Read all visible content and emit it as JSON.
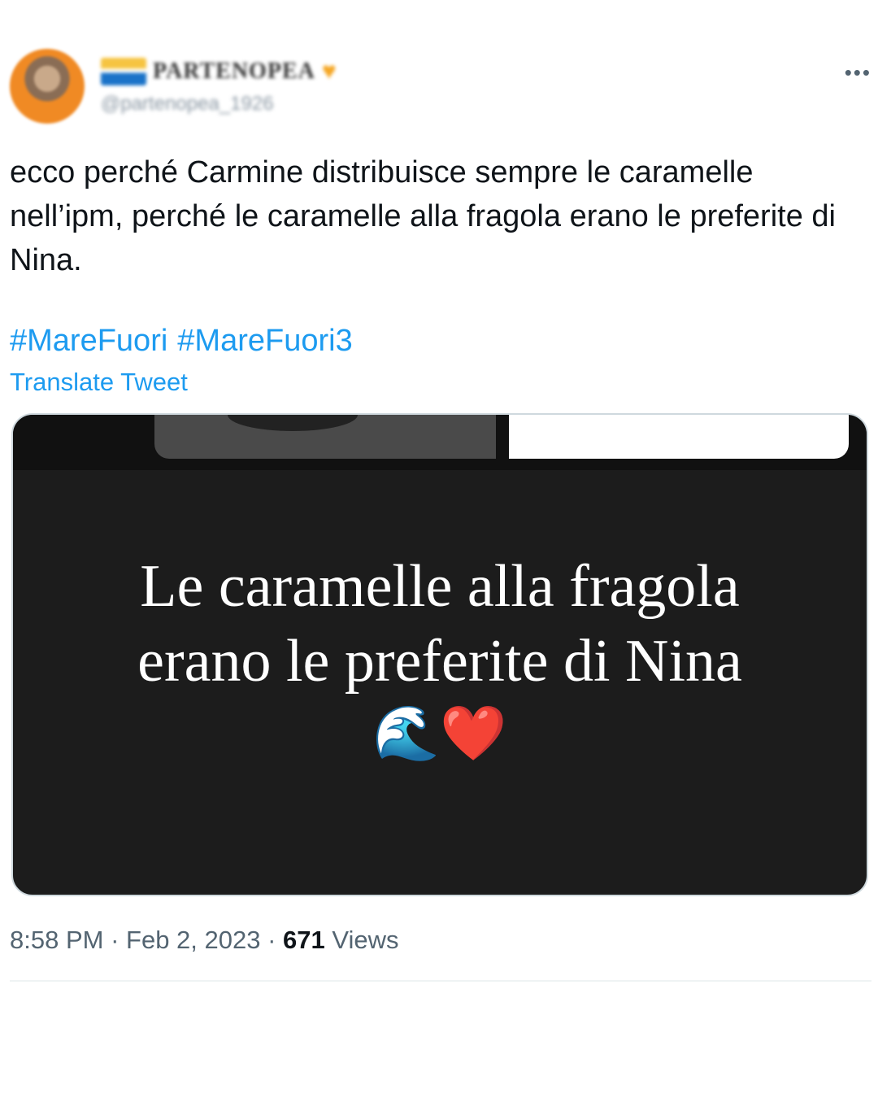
{
  "user": {
    "display_name": "PARTENOPEA",
    "handle": "@partenopea_1926"
  },
  "tweet": {
    "text": "ecco perché Carmine distribuisce sempre le caramelle nell’ipm, perché le caramelle alla fragola erano le preferite di Nina.",
    "hashtags": [
      "#MareFuori",
      "#MareFuori3"
    ],
    "translate_label": "Translate Tweet"
  },
  "media": {
    "caption_line1": "Le caramelle alla fragola",
    "caption_line2": "erano le preferite di Nina",
    "emoji_wave": "🌊",
    "emoji_heart": "❤️"
  },
  "meta": {
    "time": "8:58 PM",
    "date": "Feb 2, 2023",
    "views_count": "671",
    "views_label": "Views"
  },
  "colors": {
    "link": "#1d9bf0",
    "text": "#0f1419",
    "muted": "#536471",
    "media_bg": "#1c1c1c"
  },
  "icons": {
    "more": "more-icon",
    "name_heart": "orange-heart-icon"
  }
}
